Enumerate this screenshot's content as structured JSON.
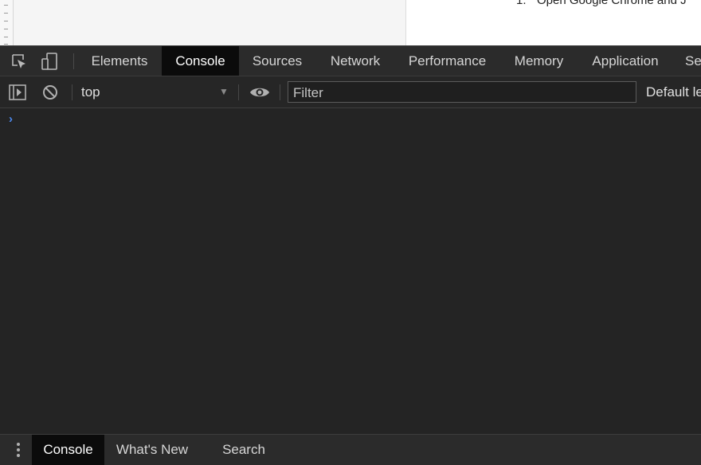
{
  "page_strip": {
    "step_number": "1.",
    "step_text": "Open Google Chrome and J"
  },
  "tabbar": {
    "icons": {
      "inspect": "inspect-element-icon",
      "device": "device-toolbar-icon"
    },
    "tabs": [
      {
        "label": "Elements",
        "active": false
      },
      {
        "label": "Console",
        "active": true
      },
      {
        "label": "Sources",
        "active": false
      },
      {
        "label": "Network",
        "active": false
      },
      {
        "label": "Performance",
        "active": false
      },
      {
        "label": "Memory",
        "active": false
      },
      {
        "label": "Application",
        "active": false
      },
      {
        "label": "Se",
        "active": false
      }
    ]
  },
  "toolbar": {
    "icons": {
      "sidebar": "show-sidebar-icon",
      "clear": "clear-console-icon",
      "eye": "live-expression-eye-icon"
    },
    "context": "top",
    "filter_placeholder": "Filter",
    "levels_label": "Default le"
  },
  "console": {
    "prompt_glyph": "›",
    "prompt_color": "#4d8af0"
  },
  "drawer": {
    "menu_icon": "kebab-menu-icon",
    "tabs": [
      {
        "label": "Console",
        "active": true
      },
      {
        "label": "What's New",
        "active": false
      },
      {
        "label": "Search",
        "active": false
      }
    ]
  },
  "colors": {
    "panel_bg": "#242424",
    "tab_active_bg": "#0b0b0b",
    "accent_blue": "#4d8af0"
  }
}
